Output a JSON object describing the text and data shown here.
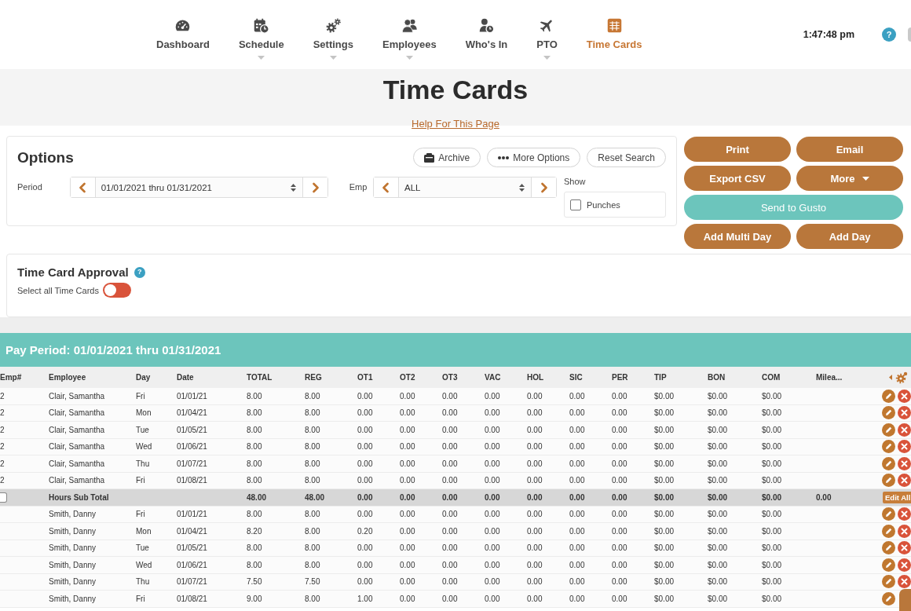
{
  "nav": {
    "items": [
      {
        "label": "Dashboard",
        "selected": false,
        "dropdown": false
      },
      {
        "label": "Schedule",
        "selected": false,
        "dropdown": true
      },
      {
        "label": "Settings",
        "selected": false,
        "dropdown": true
      },
      {
        "label": "Employees",
        "selected": false,
        "dropdown": true
      },
      {
        "label": "Who's In",
        "selected": false,
        "dropdown": false
      },
      {
        "label": "PTO",
        "selected": false,
        "dropdown": true
      },
      {
        "label": "Time Cards",
        "selected": true,
        "dropdown": false
      }
    ],
    "clock": "1:47:48 pm",
    "help_icon": "?"
  },
  "page": {
    "title": "Time Cards",
    "help_link": "Help For This Page"
  },
  "options": {
    "title": "Options",
    "buttons": [
      {
        "label": "Archive",
        "kind": "archive"
      },
      {
        "label": "More Options",
        "kind": "more"
      },
      {
        "label": "Reset Search",
        "kind": "plain"
      }
    ],
    "period": {
      "label": "Period",
      "value": "01/01/2021 thru 01/31/2021"
    },
    "employee": {
      "label": "Emp",
      "value": "ALL"
    },
    "show": {
      "label": "Show",
      "options": [
        {
          "label": "Punches",
          "checked": false
        }
      ]
    }
  },
  "actions": [
    {
      "label": "Print",
      "kind": "primary"
    },
    {
      "label": "Email",
      "kind": "primary"
    },
    {
      "label": "Export CSV",
      "kind": "primary"
    },
    {
      "label": "More",
      "kind": "dropdown"
    },
    {
      "label": "Send to Gusto",
      "kind": "wide"
    },
    {
      "label": "Add Multi Day",
      "kind": "primary"
    },
    {
      "label": "Add Day",
      "kind": "primary"
    }
  ],
  "approval": {
    "title": "Time Card Approval",
    "help_icon": "?",
    "toggle_label": "Select all Time Cards",
    "on": false
  },
  "table": {
    "title": "Pay Period: 01/01/2021 thru 01/31/2021",
    "columns": [
      "Emp#",
      "Employee",
      "Day",
      "Date",
      "TOTAL",
      "REG",
      "OT1",
      "OT2",
      "OT3",
      "VAC",
      "HOL",
      "SIC",
      "PER",
      "TIP",
      "BON",
      "COM",
      "Milea..."
    ],
    "rows": [
      {
        "kind": "entry",
        "emp": "2",
        "employee": "Clair, Samantha",
        "day": "Fri",
        "date": "01/01/21",
        "values": [
          "8.00",
          "8.00",
          "0.00",
          "0.00",
          "0.00",
          "0.00",
          "0.00",
          "0.00",
          "0.00",
          "$0.00",
          "$0.00",
          "$0.00"
        ]
      },
      {
        "kind": "entry",
        "emp": "2",
        "employee": "Clair, Samantha",
        "day": "Mon",
        "date": "01/04/21",
        "values": [
          "8.00",
          "8.00",
          "0.00",
          "0.00",
          "0.00",
          "0.00",
          "0.00",
          "0.00",
          "0.00",
          "$0.00",
          "$0.00",
          "$0.00"
        ]
      },
      {
        "kind": "entry",
        "emp": "2",
        "employee": "Clair, Samantha",
        "day": "Tue",
        "date": "01/05/21",
        "values": [
          "8.00",
          "8.00",
          "0.00",
          "0.00",
          "0.00",
          "0.00",
          "0.00",
          "0.00",
          "0.00",
          "$0.00",
          "$0.00",
          "$0.00"
        ]
      },
      {
        "kind": "entry",
        "emp": "2",
        "employee": "Clair, Samantha",
        "day": "Wed",
        "date": "01/06/21",
        "values": [
          "8.00",
          "8.00",
          "0.00",
          "0.00",
          "0.00",
          "0.00",
          "0.00",
          "0.00",
          "0.00",
          "$0.00",
          "$0.00",
          "$0.00"
        ]
      },
      {
        "kind": "entry",
        "emp": "2",
        "employee": "Clair, Samantha",
        "day": "Thu",
        "date": "01/07/21",
        "values": [
          "8.00",
          "8.00",
          "0.00",
          "0.00",
          "0.00",
          "0.00",
          "0.00",
          "0.00",
          "0.00",
          "$0.00",
          "$0.00",
          "$0.00"
        ]
      },
      {
        "kind": "entry",
        "emp": "2",
        "employee": "Clair, Samantha",
        "day": "Fri",
        "date": "01/08/21",
        "values": [
          "8.00",
          "8.00",
          "0.00",
          "0.00",
          "0.00",
          "0.00",
          "0.00",
          "0.00",
          "0.00",
          "$0.00",
          "$0.00",
          "$0.00"
        ]
      },
      {
        "kind": "subtotal",
        "checked": false,
        "label": "Hours Sub Total",
        "values": [
          "48.00",
          "48.00",
          "0.00",
          "0.00",
          "0.00",
          "0.00",
          "0.00",
          "0.00",
          "0.00",
          "$0.00",
          "$0.00",
          "$0.00"
        ],
        "milea": "0.00",
        "button": "Edit All"
      },
      {
        "kind": "entry",
        "employee": "Smith, Danny",
        "day": "Fri",
        "date": "01/01/21",
        "values": [
          "8.00",
          "8.00",
          "0.00",
          "0.00",
          "0.00",
          "0.00",
          "0.00",
          "0.00",
          "0.00",
          "$0.00",
          "$0.00",
          "$0.00"
        ]
      },
      {
        "kind": "entry",
        "employee": "Smith, Danny",
        "day": "Mon",
        "date": "01/04/21",
        "values": [
          "8.20",
          "8.00",
          "0.20",
          "0.00",
          "0.00",
          "0.00",
          "0.00",
          "0.00",
          "0.00",
          "$0.00",
          "$0.00",
          "$0.00"
        ]
      },
      {
        "kind": "entry",
        "employee": "Smith, Danny",
        "day": "Tue",
        "date": "01/05/21",
        "values": [
          "8.00",
          "8.00",
          "0.00",
          "0.00",
          "0.00",
          "0.00",
          "0.00",
          "0.00",
          "0.00",
          "$0.00",
          "$0.00",
          "$0.00"
        ]
      },
      {
        "kind": "entry",
        "employee": "Smith, Danny",
        "day": "Wed",
        "date": "01/06/21",
        "values": [
          "8.00",
          "8.00",
          "0.00",
          "0.00",
          "0.00",
          "0.00",
          "0.00",
          "0.00",
          "0.00",
          "$0.00",
          "$0.00",
          "$0.00"
        ]
      },
      {
        "kind": "entry",
        "employee": "Smith, Danny",
        "day": "Thu",
        "date": "01/07/21",
        "values": [
          "7.50",
          "7.50",
          "0.00",
          "0.00",
          "0.00",
          "0.00",
          "0.00",
          "0.00",
          "0.00",
          "$0.00",
          "$0.00",
          "$0.00"
        ]
      },
      {
        "kind": "entry",
        "employee": "Smith, Danny",
        "day": "Fri",
        "date": "01/08/21",
        "values": [
          "9.00",
          "8.00",
          "1.00",
          "0.00",
          "0.00",
          "0.00",
          "0.00",
          "0.00",
          "0.00",
          "$0.00",
          "$0.00",
          "$0.00"
        ]
      }
    ]
  }
}
